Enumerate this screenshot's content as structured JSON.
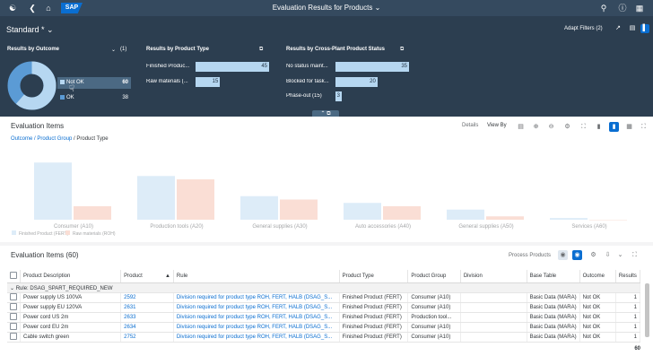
{
  "shell": {
    "title": "Evaluation Results for Products",
    "logo": "SAP"
  },
  "header": {
    "variant": "Standard *",
    "adapt_filters": "Adapt Filters (2)",
    "cards": {
      "outcome": {
        "title": "Results by Outcome",
        "count": "(1)",
        "legend": [
          {
            "label": "Not OK",
            "value": "60",
            "color": "#b6d7f1"
          },
          {
            "label": "OK",
            "value": "38",
            "color": "#5b9bd5"
          }
        ]
      },
      "product_type": {
        "title": "Results by Product Type",
        "bars": [
          {
            "label": "Finished Produc...",
            "value": 45
          },
          {
            "label": "Raw materials (...",
            "value": 15
          }
        ]
      },
      "cross_plant": {
        "title": "Results by Cross-Plant Product Status",
        "bars": [
          {
            "label": "No status maint...",
            "value": 35
          },
          {
            "label": "Blocked for task...",
            "value": 20
          },
          {
            "label": "Phase-out (15)",
            "value": 3
          }
        ]
      }
    }
  },
  "evaluation_items": {
    "title": "Evaluation Items",
    "breadcrumb_link": "Outcome / Product Group",
    "breadcrumb_rest": " / Product Type",
    "details": "Details",
    "view_by": "View By"
  },
  "table": {
    "title": "Evaluation Items (60)",
    "process_products": "Process Products",
    "columns": [
      "Product Description",
      "Product",
      "Rule",
      "Product Type",
      "Product Group",
      "Division",
      "Base Table",
      "Outcome",
      "Results"
    ],
    "group_label": "Rule: DSAG_SPART_REQUIRED_NEW",
    "rows": [
      [
        "Power supply US 100VA",
        "2592",
        "Division required for product type ROH, FERT, HALB (DSAG_S...",
        "Finished Product (FERT)",
        "Consumer (A10)",
        "",
        "Basic Data (MARA)",
        "Not OK",
        "1"
      ],
      [
        "Power supply EU 120VA",
        "2631",
        "Division required for product type ROH, FERT, HALB (DSAG_S...",
        "Finished Product (FERT)",
        "Consumer (A10)",
        "",
        "Basic Data (MARA)",
        "Not OK",
        "1"
      ],
      [
        "Power cord US 2m",
        "2633",
        "Division required for product type ROH, FERT, HALB (DSAG_S...",
        "Finished Product (FERT)",
        "Production tool...",
        "",
        "Basic Data (MARA)",
        "Not OK",
        "1"
      ],
      [
        "Power cord EU 2m",
        "2634",
        "Division required for product type ROH, FERT, HALB (DSAG_S...",
        "Finished Product (FERT)",
        "Consumer (A10)",
        "",
        "Basic Data (MARA)",
        "Not OK",
        "1"
      ],
      [
        "Cable switch green",
        "2752",
        "Division required for product type ROH, FERT, HALB (DSAG_S...",
        "Finished Product (FERT)",
        "Consumer (A10)",
        "",
        "Basic Data (MARA)",
        "Not OK",
        "1"
      ]
    ],
    "total": "60"
  },
  "chart_data": {
    "type": "bar",
    "categories": [
      "Consumer (A10)",
      "Production tools (A20)",
      "General supplies (A30)",
      "Auto accessories (A40)",
      "General supplies (A50)",
      "Services (A60)"
    ],
    "series": [
      {
        "name": "Finished Product (FERT)",
        "color": "#b6d7f1",
        "values": [
          17,
          13,
          7,
          5,
          3,
          0.5
        ]
      },
      {
        "name": "Raw materials (ROH)",
        "color": "#f4b8a3",
        "values": [
          4,
          12,
          6,
          4,
          1,
          0
        ]
      }
    ],
    "ylim": [
      0,
      20
    ]
  }
}
